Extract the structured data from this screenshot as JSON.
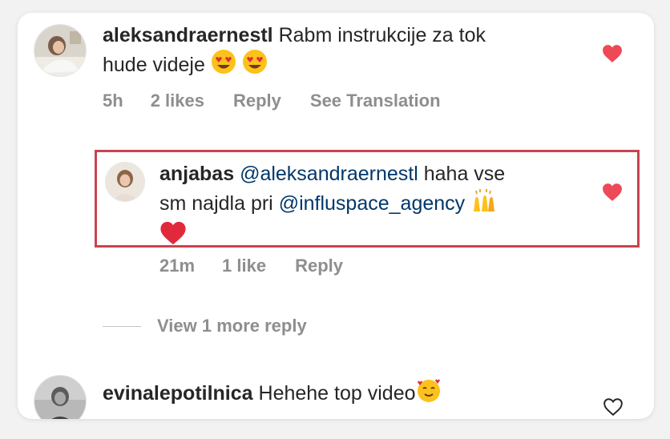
{
  "comments": [
    {
      "username": "aleksandraernestl",
      "text": "Rabm instrukcije za tok hude videje",
      "text_line1": "Rabm instrukcije za tok",
      "text_line2": "hude videje",
      "emojis": [
        "heart-eyes-emoji",
        "heart-eyes-emoji"
      ],
      "time": "5h",
      "likes": "2 likes",
      "reply": "Reply",
      "translation": "See Translation",
      "liked": true
    }
  ],
  "reply": {
    "username": "anjabas",
    "mention": "@aleksandraernestl",
    "text_part1": "haha vse",
    "text_part2": "sm najdla pri",
    "mention2": "@influspace_agency",
    "emojis": [
      "raising-hands-emoji",
      "red-heart-emoji"
    ],
    "time": "21m",
    "likes": "1 like",
    "reply": "Reply",
    "liked": true
  },
  "view_more": "View 1 more reply",
  "comment2": {
    "username": "evinalepotilnica",
    "text": "Hehehe top video",
    "emojis": [
      "smiling-face-with-hearts-emoji"
    ],
    "liked": false
  },
  "colors": {
    "heart_liked": "#ed4956",
    "highlight_border": "#c9434f",
    "mention": "#00376b",
    "meta": "#8e8e8e"
  }
}
